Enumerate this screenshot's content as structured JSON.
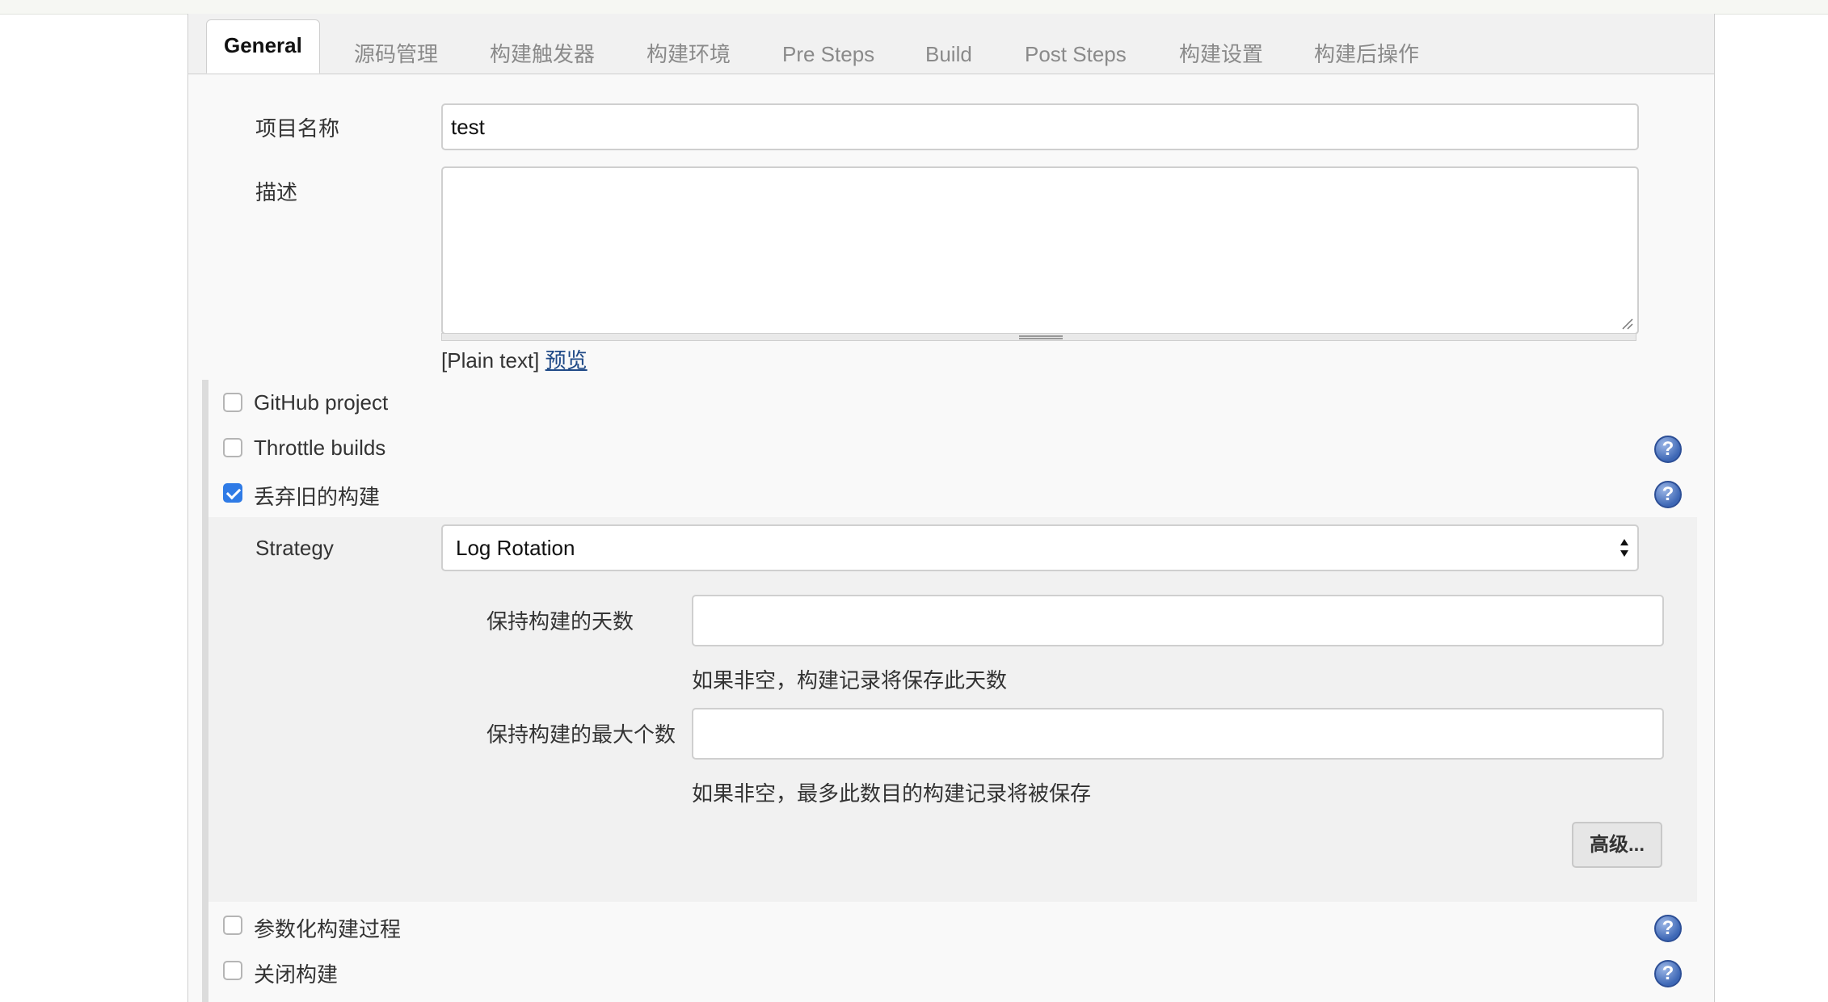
{
  "tabs": [
    {
      "label": "General",
      "active": true
    },
    {
      "label": "源码管理"
    },
    {
      "label": "构建触发器"
    },
    {
      "label": "构建环境"
    },
    {
      "label": "Pre Steps"
    },
    {
      "label": "Build"
    },
    {
      "label": "Post Steps"
    },
    {
      "label": "构建设置"
    },
    {
      "label": "构建后操作"
    }
  ],
  "project_name": {
    "label": "项目名称",
    "value": "test"
  },
  "description": {
    "label": "描述",
    "value": "",
    "format_text": "[Plain text]",
    "preview_link": "预览"
  },
  "options": {
    "github_project": {
      "label": "GitHub project",
      "checked": false
    },
    "throttle_builds": {
      "label": "Throttle builds",
      "checked": false
    },
    "discard_old_builds": {
      "label": "丢弃旧的构建",
      "checked": true
    },
    "parameterized": {
      "label": "参数化构建过程",
      "checked": false
    },
    "disable_build": {
      "label": "关闭构建",
      "checked": false
    }
  },
  "strategy": {
    "label": "Strategy",
    "selected": "Log Rotation",
    "days_to_keep": {
      "label": "保持构建的天数",
      "value": "",
      "hint": "如果非空，构建记录将保存此天数"
    },
    "max_to_keep": {
      "label": "保持构建的最大个数",
      "value": "",
      "hint": "如果非空，最多此数目的构建记录将被保存"
    },
    "advanced_button": "高级..."
  },
  "help_icon_glyph": "?",
  "colors": {
    "accent": "#2f7be6",
    "link": "#204a87",
    "help": "#3d67b5"
  }
}
